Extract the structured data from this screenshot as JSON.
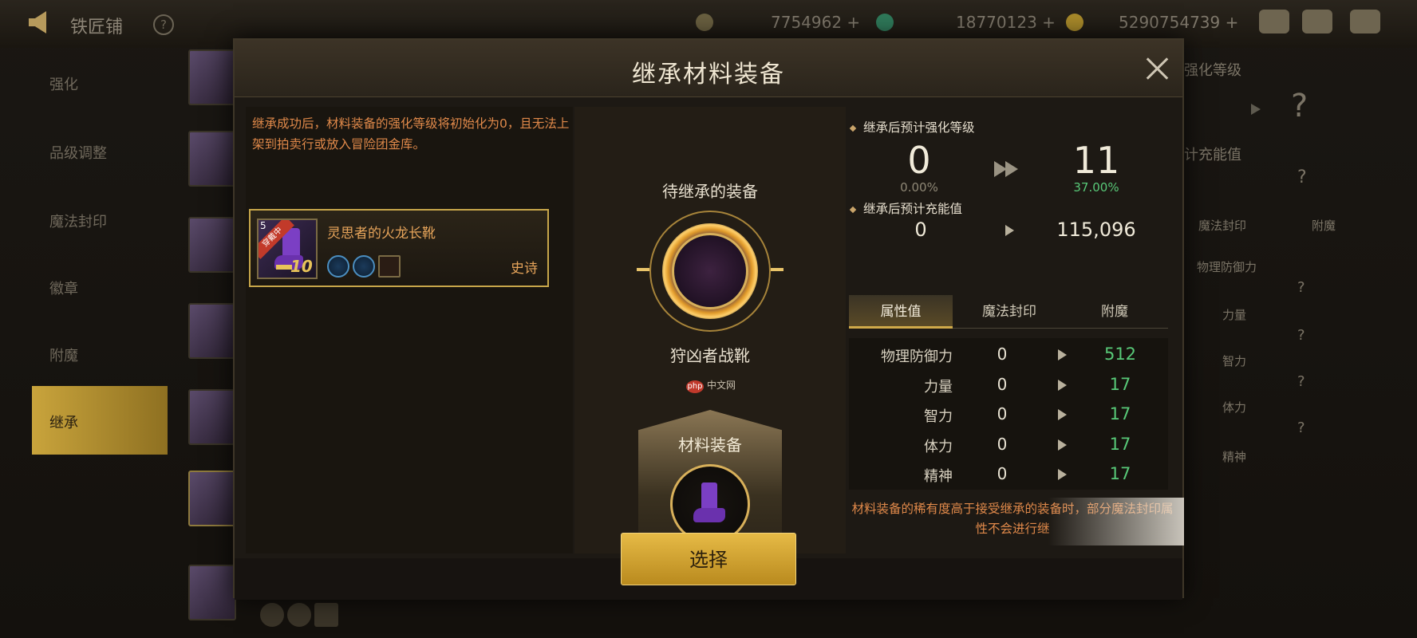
{
  "topbar": {
    "title": "铁匠铺",
    "help": "?",
    "currencies": [
      {
        "icon": "gold-coin-icon",
        "value": "7754962 +"
      },
      {
        "icon": "crystal-icon",
        "value": "18770123 +"
      },
      {
        "icon": "coin-icon",
        "value": "5290754739 +"
      }
    ]
  },
  "leftmenu": {
    "items": [
      "强化",
      "品级调整",
      "魔法封印",
      "徽章",
      "附魔",
      "继承"
    ]
  },
  "rightbg": {
    "header": "强化等级",
    "charge": "计充能值",
    "tab_a": "魔法封印",
    "tab_b": "附魔",
    "attrs": [
      "物理防御力",
      "力量",
      "智力",
      "体力",
      "精神"
    ],
    "q": "?"
  },
  "modal": {
    "title": "继承材料装备",
    "warning": "继承成功后，材料装备的强化等级将初始化为0，且无法上架到拍卖行或放入冒险团金库。",
    "item": {
      "ribbon": "穿戴中",
      "tag": "5",
      "level": "10",
      "name": "灵思者的火龙长靴",
      "rarity": "史诗"
    },
    "center": {
      "inherit_label": "待继承的装备",
      "target_name": "狩凶者战靴",
      "watermark_logo": "php",
      "watermark_text": "中文网",
      "material_label": "材料装备"
    },
    "right": {
      "enhance_label": "继承后预计强化等级",
      "enhance_from": "0",
      "enhance_from_pct": "0.00%",
      "enhance_to": "11",
      "enhance_to_pct": "37.00%",
      "charge_label": "继承后预计充能值",
      "charge_from": "0",
      "charge_to": "115,096",
      "tabs": [
        "属性值",
        "魔法封印",
        "附魔"
      ],
      "attrs": [
        {
          "name": "物理防御力",
          "from": "0",
          "to": "512"
        },
        {
          "name": "力量",
          "from": "0",
          "to": "17"
        },
        {
          "name": "智力",
          "from": "0",
          "to": "17"
        },
        {
          "name": "体力",
          "from": "0",
          "to": "17"
        },
        {
          "name": "精神",
          "from": "0",
          "to": "17"
        }
      ],
      "footnote": "材料装备的稀有度高于接受继承的装备时，部分魔法封印属性不会进行继"
    },
    "select_button": "选择"
  },
  "colors": {
    "accent_gold": "#c9a43c",
    "warning_orange": "#e0894a",
    "increase_green": "#58c978"
  }
}
